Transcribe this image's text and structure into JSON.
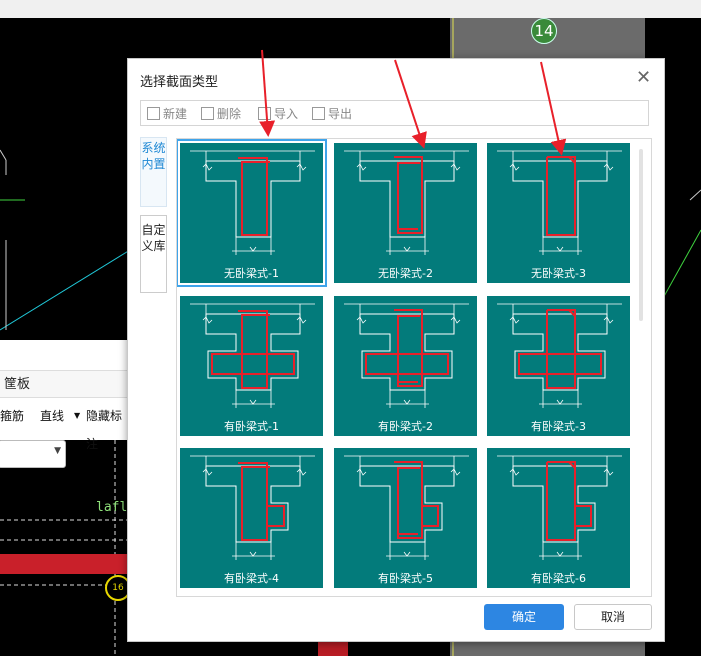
{
  "background": {
    "grid_label_top": "14",
    "grid_label_bottom": "16",
    "panel_title": "筐板",
    "panel_tools": [
      "箍筋",
      "直线",
      "隐藏标注"
    ],
    "code_text": "lafl"
  },
  "dialog": {
    "title": "选择截面类型",
    "close": "✕",
    "toolbar": {
      "new": "新建",
      "delete": "删除",
      "import": "导入",
      "export": "导出"
    },
    "sidetabs": {
      "builtin": "系统内置",
      "custom": "自定义库"
    },
    "items": [
      {
        "label": "无卧梁式-1",
        "type": "wu",
        "variant": 1,
        "selected": true
      },
      {
        "label": "无卧梁式-2",
        "type": "wu",
        "variant": 2
      },
      {
        "label": "无卧梁式-3",
        "type": "wu",
        "variant": 3
      },
      {
        "label": "有卧梁式-1",
        "type": "you",
        "variant": 1
      },
      {
        "label": "有卧梁式-2",
        "type": "you",
        "variant": 2
      },
      {
        "label": "有卧梁式-3",
        "type": "you",
        "variant": 3
      },
      {
        "label": "有卧梁式-4",
        "type": "you2",
        "variant": 1
      },
      {
        "label": "有卧梁式-5",
        "type": "you2",
        "variant": 2
      },
      {
        "label": "有卧梁式-6",
        "type": "you2",
        "variant": 3
      }
    ],
    "ok": "确定",
    "cancel": "取消"
  },
  "colors": {
    "teal": "#037b7b",
    "accent": "#2d86e2",
    "rebar": "#e8202a",
    "arrow": "#e8202a"
  }
}
